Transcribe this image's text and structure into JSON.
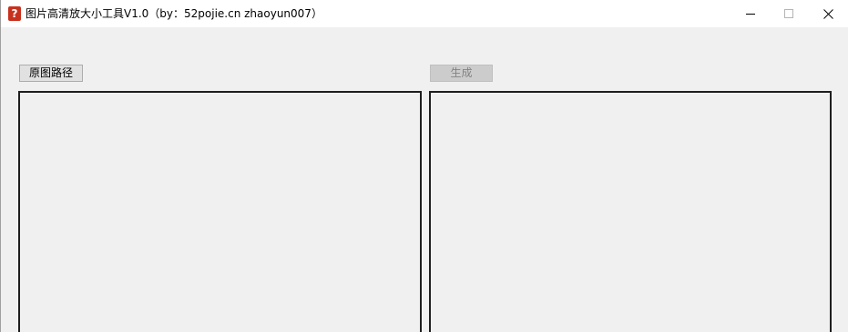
{
  "window": {
    "title": "图片高清放大小工具V1.0（by：52pojie.cn zhaoyun007）",
    "app_icon_glyph": "?",
    "controls": {
      "minimize_icon": "minimize-icon",
      "maximize_icon": "maximize-icon",
      "close_icon": "close-icon"
    }
  },
  "toolbar": {
    "source_path_label": "原图路径",
    "generate_label": "生成",
    "generate_enabled": false
  },
  "panels": {
    "left": "source-image-panel",
    "right": "output-image-panel"
  },
  "colors": {
    "window_bg": "#f0f0f0",
    "titlebar_bg": "#ffffff",
    "icon_red": "#c8301e",
    "panel_border": "#1e1e1e"
  }
}
